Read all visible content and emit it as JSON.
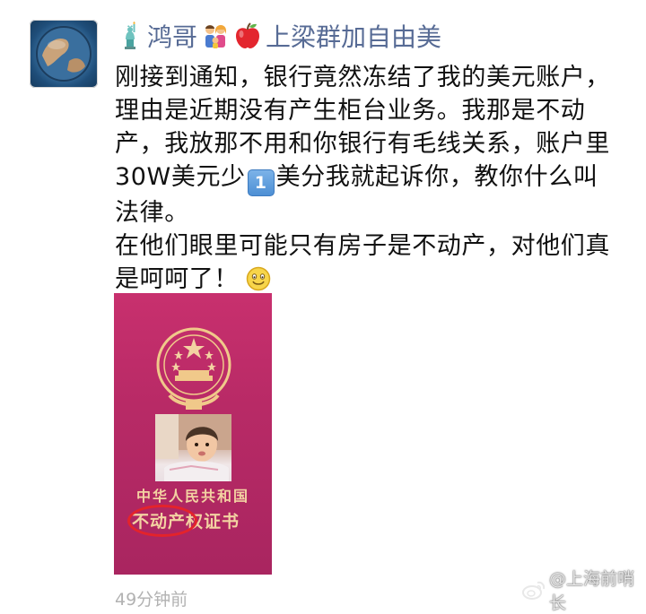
{
  "post": {
    "author_name_part1": "鸿哥",
    "author_name_part2": "上梁群加自由美",
    "name_icons": [
      "statue-of-liberty-icon",
      "family-icon",
      "red-apple-icon"
    ],
    "message": {
      "line1": "刚接到通知，银行竟然冻结了我的美元账户，理由是近期没有产生柜台业务。我那是不动产，我放那不用和你银行有毛线关系，账户里30W美元少",
      "keycap": "1",
      "line1_tail": "美分我就起诉你，教你什么叫法律。",
      "line2": "在他们眼里可能只有房子是不动产，对他们真是呵呵了！"
    },
    "image": {
      "title_line1": "中华人民共和国",
      "title_line2": "不动产权证书"
    },
    "timestamp": "49分钟前"
  },
  "watermark": {
    "text": "@上海前哨长"
  },
  "colors": {
    "name": "#576b95",
    "timestamp": "#b2b2b2",
    "certificate": "#b82a66",
    "circle_mark": "#e4232b"
  }
}
